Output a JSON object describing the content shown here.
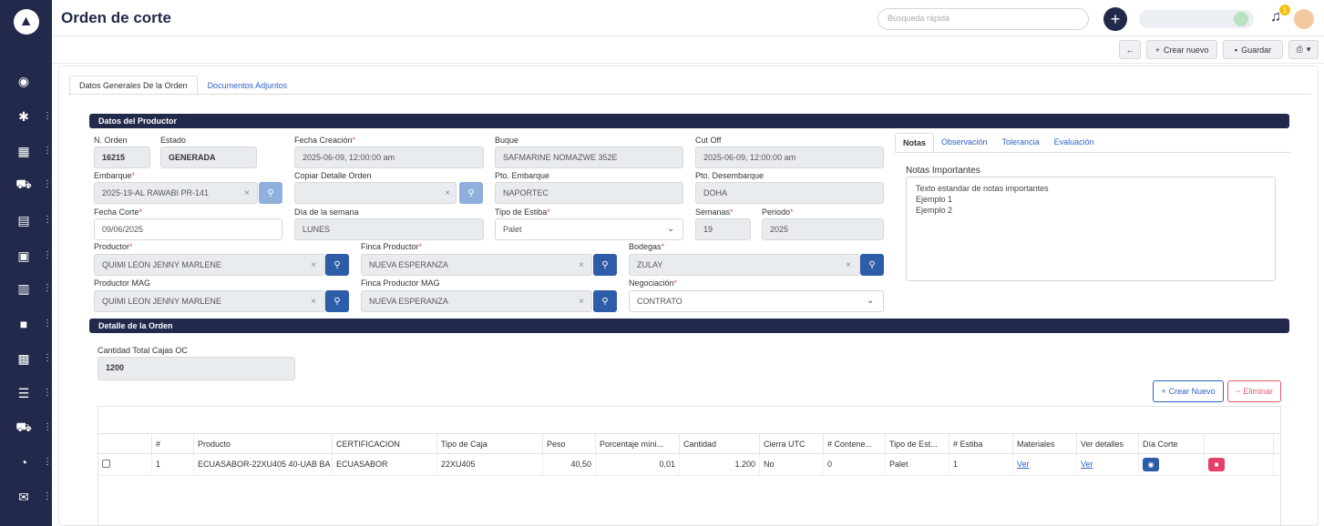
{
  "header": {
    "title": "Orden de corte",
    "search_placeholder": "Búsqueda rápida",
    "notification_count": "1"
  },
  "toolbar": {
    "back_label": "←",
    "new_label": "Crear nuevo",
    "save_label": "Guardar"
  },
  "tabs": [
    {
      "label": "Datos Generales De la Orden"
    },
    {
      "label": "Documentos Adjuntos"
    }
  ],
  "producer_section": {
    "title": "Datos del Productor",
    "n_orden": {
      "label": "N. Orden",
      "value": "16215"
    },
    "estado": {
      "label": "Estado",
      "value": "GENERADA"
    },
    "fecha_creacion": {
      "label": "Fecha Creación",
      "value": "2025-06-09, 12:00:00 am"
    },
    "buque": {
      "label": "Buque",
      "value": "SAFMARINE NOMAZWE 352E"
    },
    "cut_off": {
      "label": "Cut Off",
      "value": "2025-06-09, 12:00:00 am"
    },
    "embarque": {
      "label": "Embarque",
      "value": "2025-19-AL RAWABI PR-141"
    },
    "copiar_detalle": {
      "label": "Copiar Detalle Orden",
      "value": ""
    },
    "pto_embarque": {
      "label": "Pto. Embarque",
      "value": "NAPORTEC"
    },
    "pto_desembarque": {
      "label": "Pto. Desembarque",
      "value": "DOHA"
    },
    "fecha_corte": {
      "label": "Fecha Corte",
      "value": "09/06/2025"
    },
    "dia_semana": {
      "label": "Día de la semana",
      "value": "LUNES"
    },
    "tipo_estiba": {
      "label": "Tipo de Estiba",
      "value": "Palet"
    },
    "semanas": {
      "label": "Semanas",
      "value": "19"
    },
    "periodo": {
      "label": "Periodo",
      "value": "2025"
    },
    "productor": {
      "label": "Productor",
      "value": "QUIMI LEON JENNY MARLENE"
    },
    "finca_productor": {
      "label": "Finca Productor",
      "value": "NUEVA ESPERANZA"
    },
    "bodegas": {
      "label": "Bodegas",
      "value": "ZULAY"
    },
    "productor_mag": {
      "label": "Productor MAG",
      "value": "QUIMI LEON JENNY MARLENE"
    },
    "finca_productor_mag": {
      "label": "Finca Productor MAG",
      "value": "NUEVA ESPERANZA"
    },
    "negociacion": {
      "label": "Negociación",
      "value": "CONTRATO"
    }
  },
  "notes": {
    "tabs": [
      "Notas",
      "Observación",
      "Tolerancia",
      "Evaluación"
    ],
    "label": "Notas Importantes",
    "lines": [
      "Texto estandar de notas importantes",
      "Ejemplo 1",
      "Ejemplo 2"
    ]
  },
  "detail_section": {
    "title": "Detalle de la Orden",
    "total_label": "Cantidad Total Cajas OC",
    "total_value": "1200",
    "new_button": "Crear Nuevo",
    "delete_button": "Eliminar"
  },
  "grid": {
    "columns": [
      "#",
      "Producto",
      "CERTIFICACION",
      "Tipo de Caja",
      "Peso",
      "Porcentaje míni...",
      "Cantidad",
      "Cierra UTC",
      "# Contene...",
      "Tipo de Est...",
      "# Estiba",
      "Materiales",
      "Ver detalles",
      "Día Corte"
    ],
    "rows": [
      {
        "num": "1",
        "producto": "ECUASABOR-22XU405 40-UAB BA",
        "certificacion": "ECUASABOR",
        "tipo_caja": "22XU405",
        "peso": "40,50",
        "porcentaje": "0,01",
        "cantidad": "1.200",
        "cierra_utc": "No",
        "contenedores": "0",
        "tipo_estiba": "Palet",
        "estiba": "1",
        "materiales": "Ver",
        "ver_detalles": "Ver"
      }
    ]
  }
}
